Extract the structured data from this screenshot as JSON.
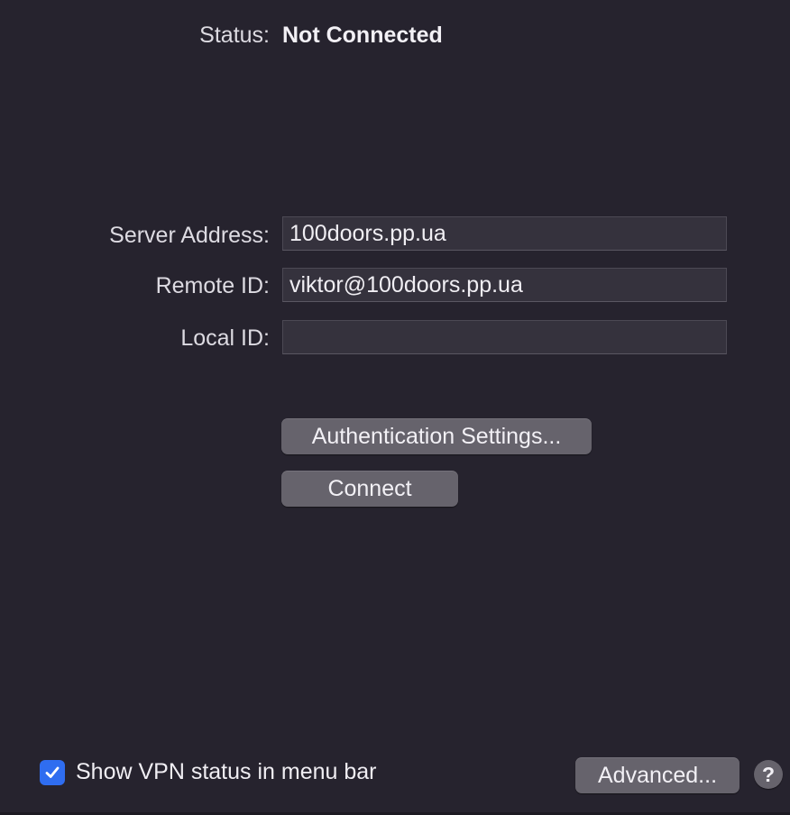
{
  "status": {
    "label": "Status:",
    "value": "Not Connected"
  },
  "form": {
    "server_address": {
      "label": "Server Address:",
      "value": "100doors.pp.ua"
    },
    "remote_id": {
      "label": "Remote ID:",
      "value": "viktor@100doors.pp.ua"
    },
    "local_id": {
      "label": "Local ID:",
      "value": ""
    }
  },
  "buttons": {
    "auth_settings": "Authentication Settings...",
    "connect": "Connect",
    "advanced": "Advanced...",
    "help": "?"
  },
  "footer": {
    "show_vpn_status_label": "Show VPN status in menu bar",
    "show_vpn_status_checked": true
  },
  "colors": {
    "background": "#26232e",
    "field_bg": "#35323d",
    "button_bg": "#66636c",
    "accent_checkbox": "#2f6df0"
  },
  "icons": {
    "checkbox": "checkmark-icon",
    "help": "question-mark-icon"
  }
}
